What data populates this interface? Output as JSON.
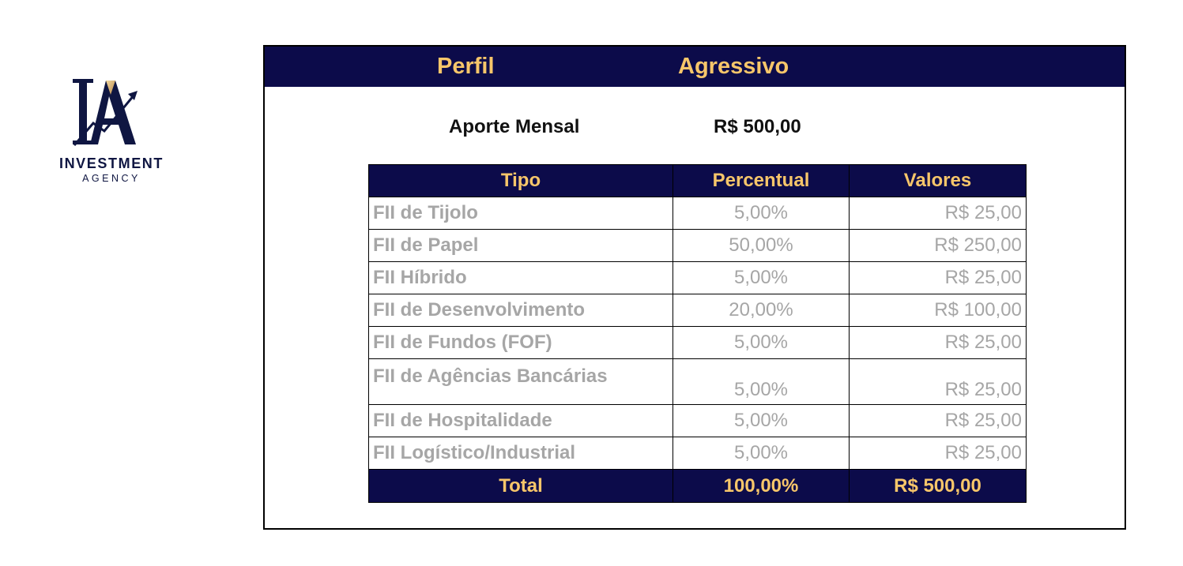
{
  "logo": {
    "line1": "INVESTMENT",
    "line2": "AGENCY"
  },
  "perfil": {
    "label": "Perfil",
    "value": "Agressivo"
  },
  "aporte": {
    "label": "Aporte Mensal",
    "value": "R$ 500,00"
  },
  "table": {
    "headers": {
      "tipo": "Tipo",
      "percentual": "Percentual",
      "valores": "Valores"
    },
    "rows": [
      {
        "tipo": "FII de Tijolo",
        "percentual": "5,00%",
        "valor": "R$ 25,00"
      },
      {
        "tipo": "FII de Papel",
        "percentual": "50,00%",
        "valor": "R$ 250,00"
      },
      {
        "tipo": "FII Híbrido",
        "percentual": "5,00%",
        "valor": "R$ 25,00"
      },
      {
        "tipo": "FII de Desenvolvimento",
        "percentual": "20,00%",
        "valor": "R$ 100,00"
      },
      {
        "tipo": "FII de Fundos (FOF)",
        "percentual": "5,00%",
        "valor": "R$ 25,00"
      },
      {
        "tipo": "FII de Agências Bancárias",
        "percentual": "5,00%",
        "valor": "R$ 25,00"
      },
      {
        "tipo": "FII de Hospitalidade",
        "percentual": "5,00%",
        "valor": "R$ 25,00"
      },
      {
        "tipo": "FII Logístico/Industrial",
        "percentual": "5,00%",
        "valor": "R$ 25,00"
      }
    ],
    "total": {
      "label": "Total",
      "percentual": "100,00%",
      "valor": "R$ 500,00"
    }
  },
  "colors": {
    "navy": "#0c0b4a",
    "gold": "#f7c66a",
    "row_text": "#a6a6a6"
  }
}
